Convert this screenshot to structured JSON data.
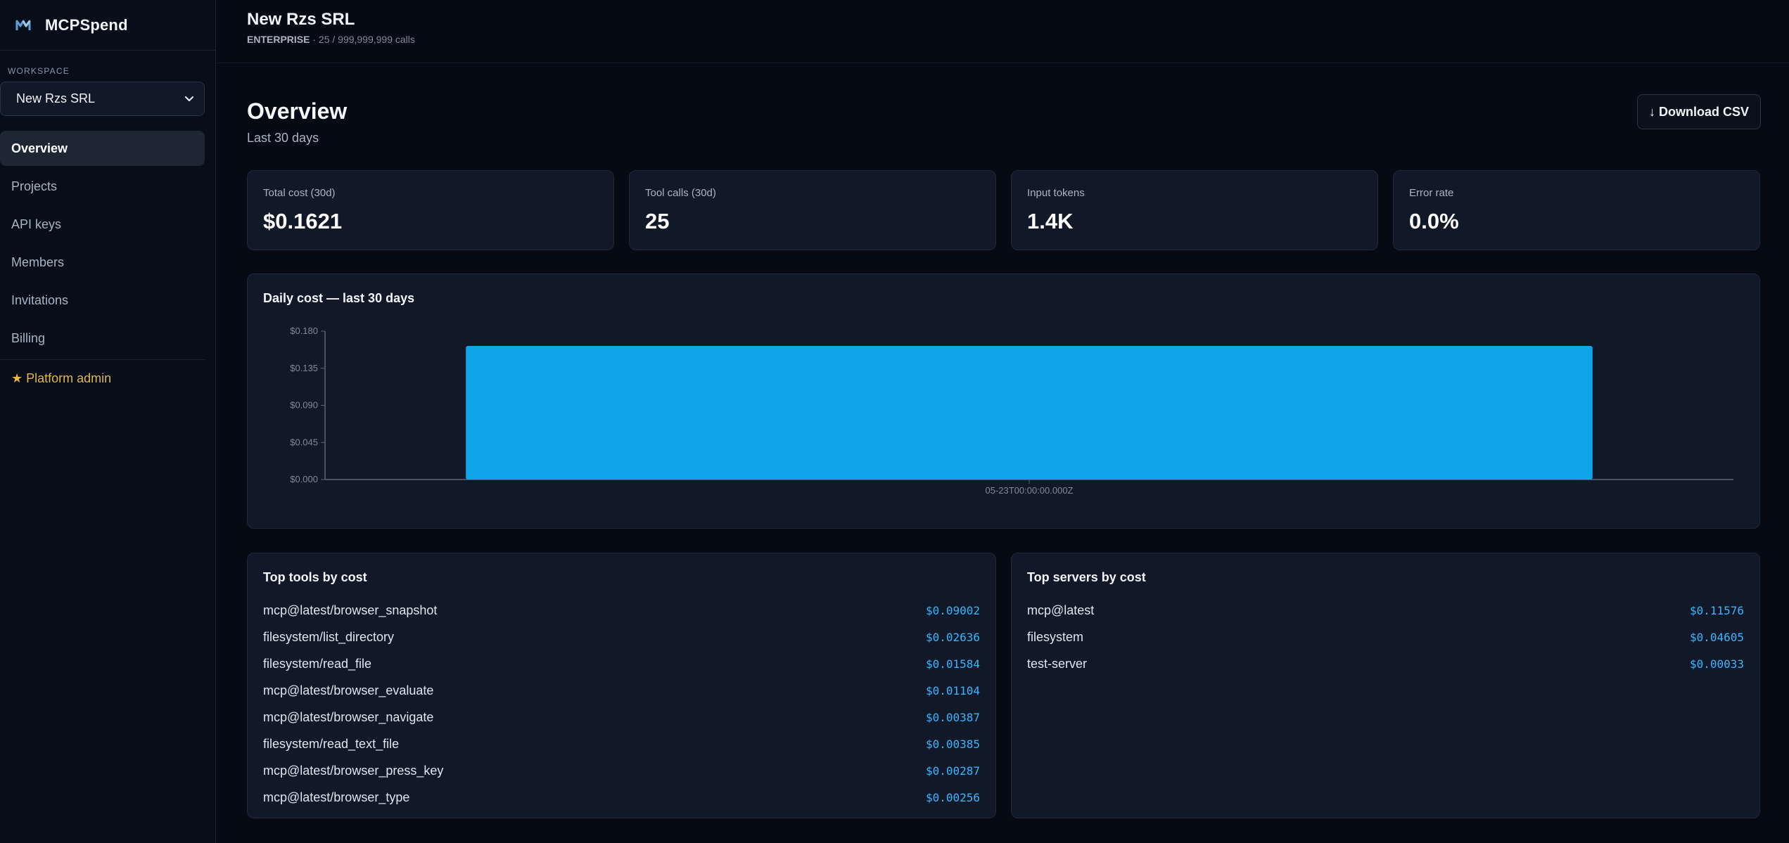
{
  "app": {
    "name": "MCPSpend"
  },
  "sidebar": {
    "workspace_label": "WORKSPACE",
    "workspace_value": "New Rzs SRL",
    "items": [
      {
        "label": "Overview",
        "active": true
      },
      {
        "label": "Projects"
      },
      {
        "label": "API keys"
      },
      {
        "label": "Members"
      },
      {
        "label": "Invitations"
      },
      {
        "label": "Billing"
      }
    ],
    "admin_label": "★ Platform admin"
  },
  "header": {
    "org_name": "New Rzs SRL",
    "plan": "ENTERPRISE",
    "usage": " · 25 / 999,999,999 calls"
  },
  "page": {
    "title": "Overview",
    "subtitle": "Last 30 days",
    "download_label": "↓ Download CSV"
  },
  "stats": [
    {
      "label": "Total cost (30d)",
      "value": "$0.1621"
    },
    {
      "label": "Tool calls (30d)",
      "value": "25"
    },
    {
      "label": "Input tokens",
      "value": "1.4K"
    },
    {
      "label": "Error rate",
      "value": "0.0%"
    }
  ],
  "chart": {
    "title": "Daily cost — last 30 days"
  },
  "chart_data": {
    "type": "bar",
    "title": "Daily cost — last 30 days",
    "categories": [
      "05-23T00:00:00.000Z"
    ],
    "values": [
      0.1621
    ],
    "ylim": [
      0,
      0.18
    ],
    "yticks": [
      "$0.000",
      "$0.045",
      "$0.090",
      "$0.135",
      "$0.180"
    ],
    "bar_color": "#0ea5e9"
  },
  "top_tools": {
    "title": "Top tools by cost",
    "rows": [
      {
        "name": "mcp@latest/browser_snapshot",
        "value": "$0.09002"
      },
      {
        "name": "filesystem/list_directory",
        "value": "$0.02636"
      },
      {
        "name": "filesystem/read_file",
        "value": "$0.01584"
      },
      {
        "name": "mcp@latest/browser_evaluate",
        "value": "$0.01104"
      },
      {
        "name": "mcp@latest/browser_navigate",
        "value": "$0.00387"
      },
      {
        "name": "filesystem/read_text_file",
        "value": "$0.00385"
      },
      {
        "name": "mcp@latest/browser_press_key",
        "value": "$0.00287"
      },
      {
        "name": "mcp@latest/browser_type",
        "value": "$0.00256"
      }
    ]
  },
  "top_servers": {
    "title": "Top servers by cost",
    "rows": [
      {
        "name": "mcp@latest",
        "value": "$0.11576"
      },
      {
        "name": "filesystem",
        "value": "$0.04605"
      },
      {
        "name": "test-server",
        "value": "$0.00033"
      }
    ]
  },
  "colors": {
    "accent": "#0ea5e9",
    "value_text": "#38b6ff",
    "admin": "#e4b54a"
  }
}
